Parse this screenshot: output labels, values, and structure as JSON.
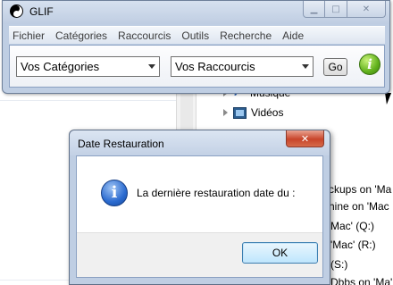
{
  "app": {
    "title": "GLIF",
    "menu": [
      "Fichier",
      "Catégories",
      "Raccourcis",
      "Outils",
      "Recherche",
      "Aide"
    ],
    "toolbar": {
      "categories_value": "Vos Catégories",
      "shortcuts_value": "Vos Raccourcis",
      "go_label": "Go",
      "info_glyph": "i"
    },
    "caption": {
      "minimize_glyph": "▁",
      "maximize_glyph": "□",
      "close_glyph": "✕"
    }
  },
  "dialog": {
    "title": "Date Restauration",
    "message": "La dernière restauration date du :",
    "ok_label": "OK",
    "icon_glyph": "i",
    "close_glyph": "✕"
  },
  "background": {
    "tree": [
      "Musique",
      "Vidéos"
    ],
    "fragments": [
      "ckups on 'Ma",
      "hine on 'Mac",
      "Mac' (Q:)",
      "'Mac' (R:)",
      "(S:)",
      "Dbbs on 'Ma' (T:)"
    ]
  },
  "colors": {
    "window_frame": "#bfcee3",
    "close_button": "#c8452a",
    "ok_button_border": "#3c7fb1",
    "go_info_icon": "#61b11c",
    "dialog_info_icon": "#2b6bd0"
  }
}
